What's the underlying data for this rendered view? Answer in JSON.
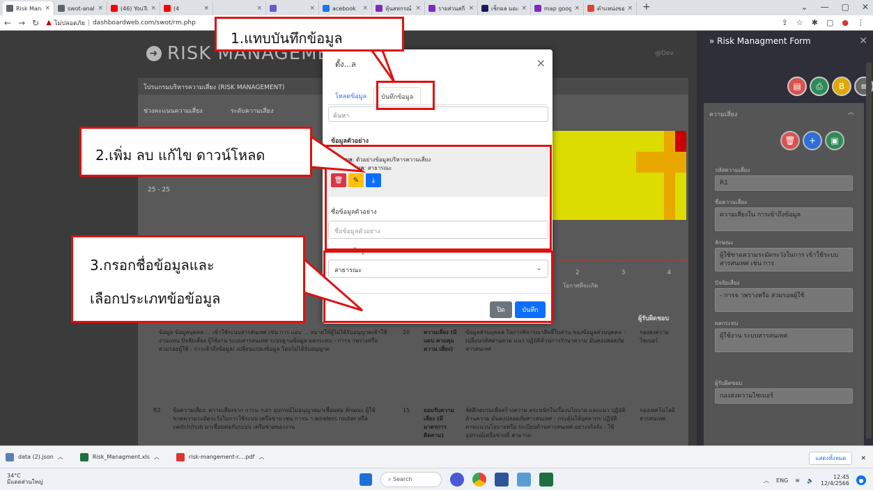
{
  "browser": {
    "tabs": [
      {
        "label": "Risk Managm",
        "color": "#5f6368"
      },
      {
        "label": "swot-analysi",
        "color": "#5f6368"
      },
      {
        "label": "(46) YouTube",
        "color": "#ff0000"
      },
      {
        "label": "(4",
        "color": "#ff0000"
      },
      {
        "label": "",
        "color": "#dee1e6"
      },
      {
        "label": "",
        "color": "#6a5acd"
      },
      {
        "label": "acebook",
        "color": "#1877f2"
      },
      {
        "label": "หุ้นสหกรณ์ ระ",
        "color": "#7b2cbf"
      },
      {
        "label": "รายส่วนสกีลส",
        "color": "#7b2cbf"
      },
      {
        "label": "เช็กผล มอเตอร์",
        "color": "#1a1a60"
      },
      {
        "label": "map google",
        "color": "#7b2cbf"
      },
      {
        "label": "ตำแหน่งของคุณ",
        "color": "#e34133"
      }
    ],
    "url_warning": "ไม่ปลอดภัย",
    "url": "dashboardweb.com/swot/rm.php"
  },
  "page": {
    "logo_text": "RISK MANAGEMENT",
    "dev_label": "@Dev",
    "panel_title": "โปรแกรมบริหารความเสี่ยง (RISK MANAGEMENT)",
    "sub_labels": [
      "ช่วงคะแนนความเสี่ยง",
      "ระดับความเสี่ยง"
    ],
    "score_label": "25 - 25",
    "x_numbers": [
      "2",
      "3",
      "4"
    ],
    "x_axis_label": "โอกาสที่จะเกิด",
    "owner_header": "ผู้รับผิดชอบ",
    "rows": [
      {
        "id": "",
        "details": "ข้อมูล ข้อมูลบุคคล ... เข้าใช้ระบบสารสนเทศ เช่น การ แอบ ... หมายให้ผู้ไม่ได้รับอนุญาตเข้าใช้งานแทน ปัจจัยเสี่ยง ผู้ใช้งาน ระบบสารสนเทศ ระบบฐานข้อมูล ผลกระทบ - การจ าพรางหรือ สวมรอยผู้ใช้ - การเข้าถึงข้อมูล/ เปลี่ยนแปลงข้อมูล โดยไม่ได้รับอนุญาต",
        "score": "20",
        "level": "ความเสี่ยง (มีแผน ควบคุมความ เสี่ยง)",
        "plan": "ข้อมูลส่วนบุคคล ในการพิจารณาสิทธิ์ในส่วน ของข้อมูลส่วนบุคคล - เปลี่ยนรหัสผ่านตาม แนว ปฏิบัติด้านการรักษาความ มั่นคงปลอดภัยสารสนเทศ",
        "owner": "กองสงความ ไซเบอร์"
      },
      {
        "id": "R2",
        "details": "ข้อความเสี่ยง: ความเสี่ยงจาก การน าเอา อุปกรณ์ไม่อนุญาตมาเชื่อมต่อ ลักษณะ ผู้ใช้ขาดความระมัดระวังในการใช้ระบบ เครือข่าย เช่น การน า wireless router หรือ switch/hub มาเชื่อมต่อกับระบบ เครือข่ายของงาน",
        "score": "15",
        "level": "ยอมรับความ เสี่ยง (มีมาตรการ ติดตาม)",
        "plan": "จัดฝึกอบรมเพื่อสร้างความ ตระหนักในเรื่องนโยบาย และแนว ปฏิบัติด้านความ มั่นคงปลอดภัยสารสนเทศ - กระตุ้นให้บุคลากร ปฏิบัติ ตามแนวนโยบายหรือ ระเบียบด้านสารสนเทศ อย่างจริงจัง - ใช้อุปกรณ์เครือข่ายที่ สามารถ",
        "owner": "กองเทคโนโลยี สารสนเทศ"
      }
    ]
  },
  "sidebar": {
    "title": "Risk Managment Form",
    "section": "ความเสี่ยง",
    "fields": [
      {
        "label": "รหัสความเสี่ยง",
        "value": "R1"
      },
      {
        "label": "ชื่อความเสี่ยง",
        "value": "ความเสี่ยงใน การเข้าถึงข้อมูล"
      },
      {
        "label": "ลักษณะ",
        "value": "ผู้ใช้ขาดความระมัดระวังในการ เข้าใช้ระบบสารสนเทศ เช่น การ"
      },
      {
        "label": "ปัจจัยเสี่ยง",
        "value": "- การจ าพรางหรือ สวมรอยผู้ใช้"
      },
      {
        "label": "ผลกระทบ",
        "value": "ผู้ใช้งาน ระบบสารสนเทศ"
      },
      {
        "label": "ผู้รับผิดชอบ",
        "value": "กองสงความไซเบอร์"
      }
    ]
  },
  "modal": {
    "title": "ตั้ง...ล",
    "tabs": [
      "โหลดข้อมูล",
      "บันทึกข้อมูล"
    ],
    "search_placeholder": "ค้นหา",
    "example_header": "ข้อมูลตัวอย่าง",
    "item_name_label": "ชื่อข้อมูล",
    "item_name_value": "ตัวอย่างข้อมูลบริหารความเสี่ยง",
    "item_type_label": "ประเภทข้อมูล",
    "item_type_value": "สาธารณะ",
    "name_label": "ชื่อข้อมูลตัวอย่าง",
    "name_placeholder": "ชื่อข้อมูลตัวอย่าง",
    "type_label": "ประเภทข้อมูล",
    "type_selected": "สาธารณะ",
    "close_button": "ปิด",
    "save_button": "บันทึก"
  },
  "annotations": {
    "a1": "1.แทบบันทึกข้อมูล",
    "a2": "2.เพิ่ม ลบ แก้ไข ดาวน์โหลด",
    "a3_line1": "3.กรอกชื่อข้อมูลและ",
    "a3_line2": "เลือกประเภทข้อข้อมูล"
  },
  "downloads": {
    "items": [
      {
        "label": "data (2).json",
        "color": "#5a7fb5"
      },
      {
        "label": "Risk_Managment.xls",
        "color": "#1d6f42"
      },
      {
        "label": "risk-mangement-r....pdf",
        "color": "#d33"
      }
    ],
    "show_all": "แสดงทั้งหมด"
  },
  "taskbar": {
    "temp": "34°C",
    "weather": "มีแดดส่วนใหญ่",
    "search": "Search",
    "lang": "ENG",
    "time": "12:45",
    "date": "12/4/2566"
  },
  "colors": {
    "accent": "#e01010",
    "primary": "#2d6fd6"
  }
}
